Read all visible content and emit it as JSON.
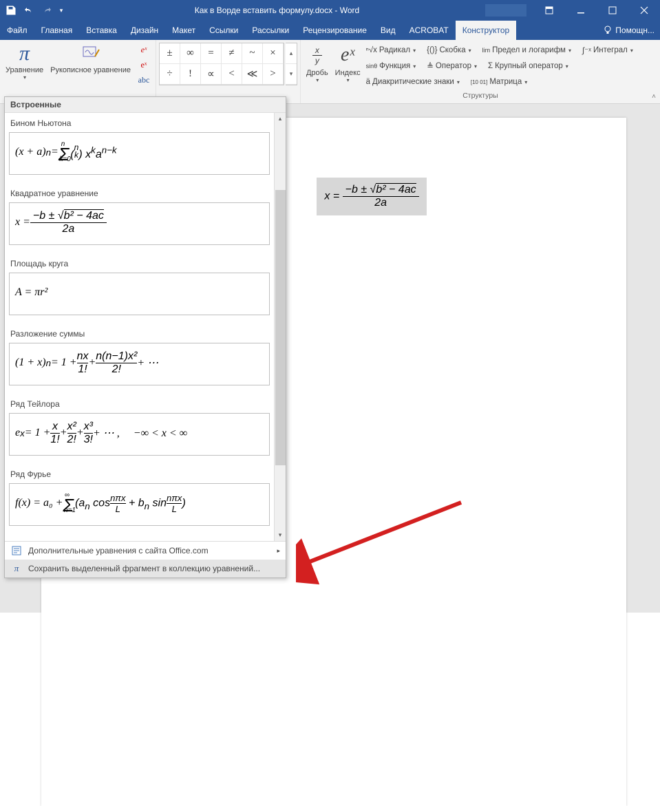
{
  "title": "Как в Ворде вставить формулу.docx - Word",
  "menubar": [
    "Файл",
    "Главная",
    "Вставка",
    "Дизайн",
    "Макет",
    "Ссылки",
    "Рассылки",
    "Рецензирование",
    "Вид",
    "ACROBAT",
    "Конструктор"
  ],
  "help_label": "Помощн...",
  "ribbon": {
    "equation_btn": "Уравнение",
    "ink_btn": "Рукописное уравнение",
    "convert": {
      "ex_top": "eˣ",
      "ex_bot": "eˣ",
      "abc": "abc"
    },
    "symbols": [
      "±",
      "∞",
      "=",
      "≠",
      "~",
      "×",
      "÷",
      "!",
      "∝",
      "<",
      "≪",
      ">"
    ],
    "structures_big": [
      {
        "icon": "x/y",
        "label": "Дробь"
      },
      {
        "icon": "eˣ",
        "label": "Индекс"
      }
    ],
    "structures_small": [
      {
        "icon": "ⁿ√x",
        "label": "Радикал"
      },
      {
        "icon": "∫⁻ˣ",
        "label": "Интеграл"
      },
      {
        "icon": "Σ",
        "label": "Крупный оператор"
      },
      {
        "icon": "{()}",
        "label": "Скобка"
      },
      {
        "icon": "sinθ",
        "label": "Функция"
      },
      {
        "icon": "ä",
        "label": "Диакритические знаки"
      },
      {
        "icon": "lim",
        "label": "Предел и логарифм"
      },
      {
        "icon": "≜",
        "label": "Оператор"
      },
      {
        "icon": "[10 01]",
        "label": "Матрица"
      }
    ],
    "structures_label": "Структуры"
  },
  "inserted_equation": "x = (−b ± √(b² − 4ac)) / 2a",
  "dropdown": {
    "header": "Встроенные",
    "items": [
      {
        "title": "Бином Ньютона",
        "formula": "(x + a)ⁿ = Σₖ₌₀ⁿ (n k) xᵏ aⁿ⁻ᵏ"
      },
      {
        "title": "Квадратное уравнение",
        "formula": "x = (−b ± √(b² − 4ac)) / 2a"
      },
      {
        "title": "Площадь круга",
        "formula": "A = πr²"
      },
      {
        "title": "Разложение суммы",
        "formula": "(1 + x)ⁿ = 1 + nx/1! + n(n−1)x²/2! + ⋯"
      },
      {
        "title": "Ряд Тейлора",
        "formula": "eˣ = 1 + x/1! + x²/2! + x³/3! + ⋯ ,   −∞ < x < ∞"
      },
      {
        "title": "Ряд Фурье",
        "formula": "f(x) = a₀ + Σₙ₌₁^∞ (aₙ cos nπx/L + bₙ sin nπx/L)"
      }
    ],
    "footer_more": "Дополнительные уравнения с сайта Office.com",
    "footer_save": "Сохранить выделенный фрагмент в коллекцию уравнений..."
  }
}
